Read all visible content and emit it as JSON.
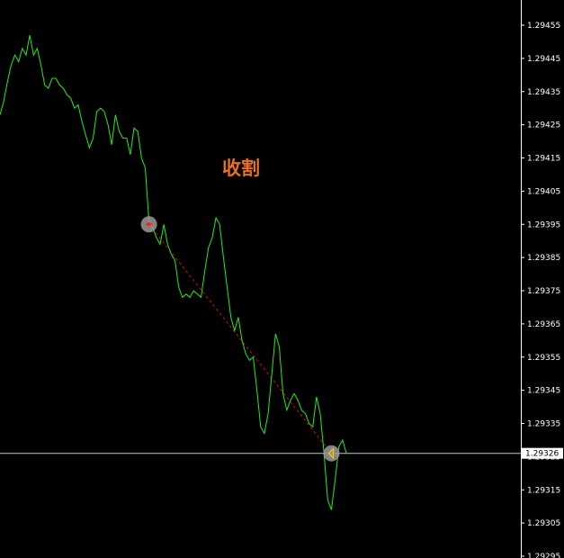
{
  "colors": {
    "background": "#000000",
    "price_line": "#22ee11",
    "axis": "#ffffff",
    "trade_line": "#cc1111",
    "annotation": "#e8701e",
    "marker_ring": "#9a9a9a",
    "entry_marker": "#ff2020",
    "exit_marker": "#e8c020",
    "current_price_line": "#b8c8d8",
    "current_price_box": "#ffffff"
  },
  "chart_data": {
    "type": "line",
    "annotation": "收割",
    "ylim": [
      1.29295,
      1.29462
    ],
    "y_ticks": [
      "1.29455",
      "1.29445",
      "1.29435",
      "1.29425",
      "1.29415",
      "1.29405",
      "1.29395",
      "1.29385",
      "1.29375",
      "1.29365",
      "1.29355",
      "1.29345",
      "1.29335",
      "1.29325",
      "1.29315",
      "1.29305",
      "1.29295"
    ],
    "current_price": "1.29326",
    "series": [
      {
        "values": [
          1.29428,
          1.29432,
          1.29438,
          1.29443,
          1.29446,
          1.29444,
          1.29448,
          1.29446,
          1.29452,
          1.29446,
          1.29448,
          1.29443,
          1.29437,
          1.29436,
          1.29439,
          1.29439,
          1.29437,
          1.29436,
          1.29434,
          1.29433,
          1.2943,
          1.29431,
          1.29426,
          1.29422,
          1.29418,
          1.29421,
          1.29429,
          1.2943,
          1.29429,
          1.29425,
          1.29419,
          1.29428,
          1.29423,
          1.29421,
          1.29421,
          1.29416,
          1.29424,
          1.29423,
          1.29415,
          1.29412,
          1.29396,
          1.29394,
          1.29391,
          1.29389,
          1.29395,
          1.29389,
          1.29386,
          1.29384,
          1.29376,
          1.29373,
          1.29374,
          1.29373,
          1.29375,
          1.29374,
          1.29373,
          1.29381,
          1.29388,
          1.29391,
          1.29397,
          1.29395,
          1.29385,
          1.29376,
          1.29367,
          1.29363,
          1.29367,
          1.2936,
          1.29356,
          1.29354,
          1.29355,
          1.29345,
          1.29334,
          1.29332,
          1.29338,
          1.2935,
          1.29362,
          1.29358,
          1.29344,
          1.29339,
          1.29342,
          1.29344,
          1.29342,
          1.29339,
          1.29338,
          1.29335,
          1.29334,
          1.29343,
          1.29338,
          1.29326,
          1.29312,
          1.29309,
          1.29318,
          1.29328,
          1.2933,
          1.29326
        ]
      }
    ],
    "trade": {
      "entry_index": 40,
      "entry_price": 1.29395,
      "exit_index": 89,
      "exit_price": 1.29326
    }
  }
}
